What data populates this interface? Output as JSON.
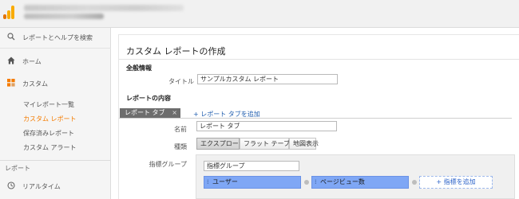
{
  "header": {
    "logo_icon": "google-analytics-logo",
    "logo_colors": [
      "#f9ab00",
      "#e37400"
    ]
  },
  "sidebar": {
    "search": {
      "icon": "search-icon",
      "label": "レポートとヘルプを検索"
    },
    "home": {
      "icon": "home-icon",
      "label": "ホーム"
    },
    "custom": {
      "icon": "custom-reports-icon",
      "label": "カスタム"
    },
    "custom_items": [
      {
        "label": "マイレポート一覧",
        "active": false
      },
      {
        "label": "カスタム レポート",
        "active": true
      },
      {
        "label": "保存済みレポート",
        "active": false
      },
      {
        "label": "カスタム アラート",
        "active": false
      }
    ],
    "section_label": "レポート",
    "realtime": {
      "icon": "clock-icon",
      "label": "リアルタイム"
    },
    "active_color": "#f57c00"
  },
  "main": {
    "title": "カスタム レポートの作成",
    "general": {
      "heading": "全般情報",
      "title_label": "タイトル",
      "title_value": "サンプルカスタム レポート"
    },
    "content": {
      "heading": "レポートの内容",
      "tab_chip": "レポート タブ",
      "tab_close": "×",
      "add_tab": "+ レポート タブを追加",
      "name_label": "名前",
      "name_value": "レポート タブ",
      "type_label": "種類",
      "types": [
        "エクスプローラ",
        "フラット テーブル",
        "地図表示"
      ],
      "selected_type": "エクスプローラ",
      "metric_group_label": "指標グループ",
      "metric_group_value": "指標グループ",
      "metrics": [
        "ユーザー",
        "ページビュー数"
      ],
      "add_metric": "+ 指標を追加",
      "metric_color": "#7fa7f5"
    }
  }
}
